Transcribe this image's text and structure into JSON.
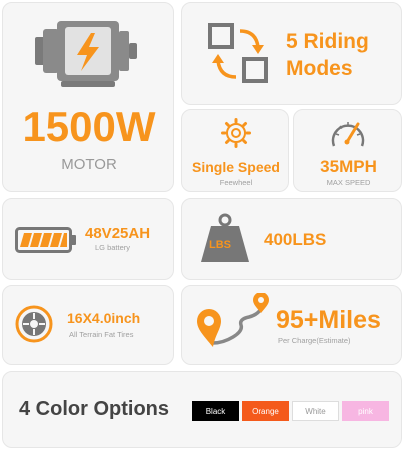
{
  "motor": {
    "power": "1500W",
    "label": "MOTOR"
  },
  "modes": {
    "line1": "5 Riding",
    "line2": "Modes"
  },
  "speed_mode": {
    "title": "Single Speed",
    "subtitle": "Feewheel"
  },
  "max_speed": {
    "value": "35MPH",
    "label": "MAX SPEED"
  },
  "battery": {
    "spec": "48V25AH",
    "subtitle": "LG battery"
  },
  "load": {
    "icon_text": "LBS",
    "value": "400LBS"
  },
  "tires": {
    "size": "16X4.0inch",
    "subtitle": "All Terrain Fat Tires"
  },
  "range": {
    "value": "95+Miles",
    "subtitle": "Per Charge(Estimate)"
  },
  "colors": {
    "title": "4 Color Options",
    "options": [
      {
        "label": "Black",
        "bg": "#000000",
        "fg": "#ffffff"
      },
      {
        "label": "Orange",
        "bg": "#f45a1b",
        "fg": "#ffffff"
      },
      {
        "label": "White",
        "bg": "#ffffff",
        "fg": "#999999"
      },
      {
        "label": "pink",
        "bg": "#f7b6e2",
        "fg": "#ffffff"
      }
    ]
  },
  "accent_color": "#f7941d",
  "icon_grey": "#777777"
}
